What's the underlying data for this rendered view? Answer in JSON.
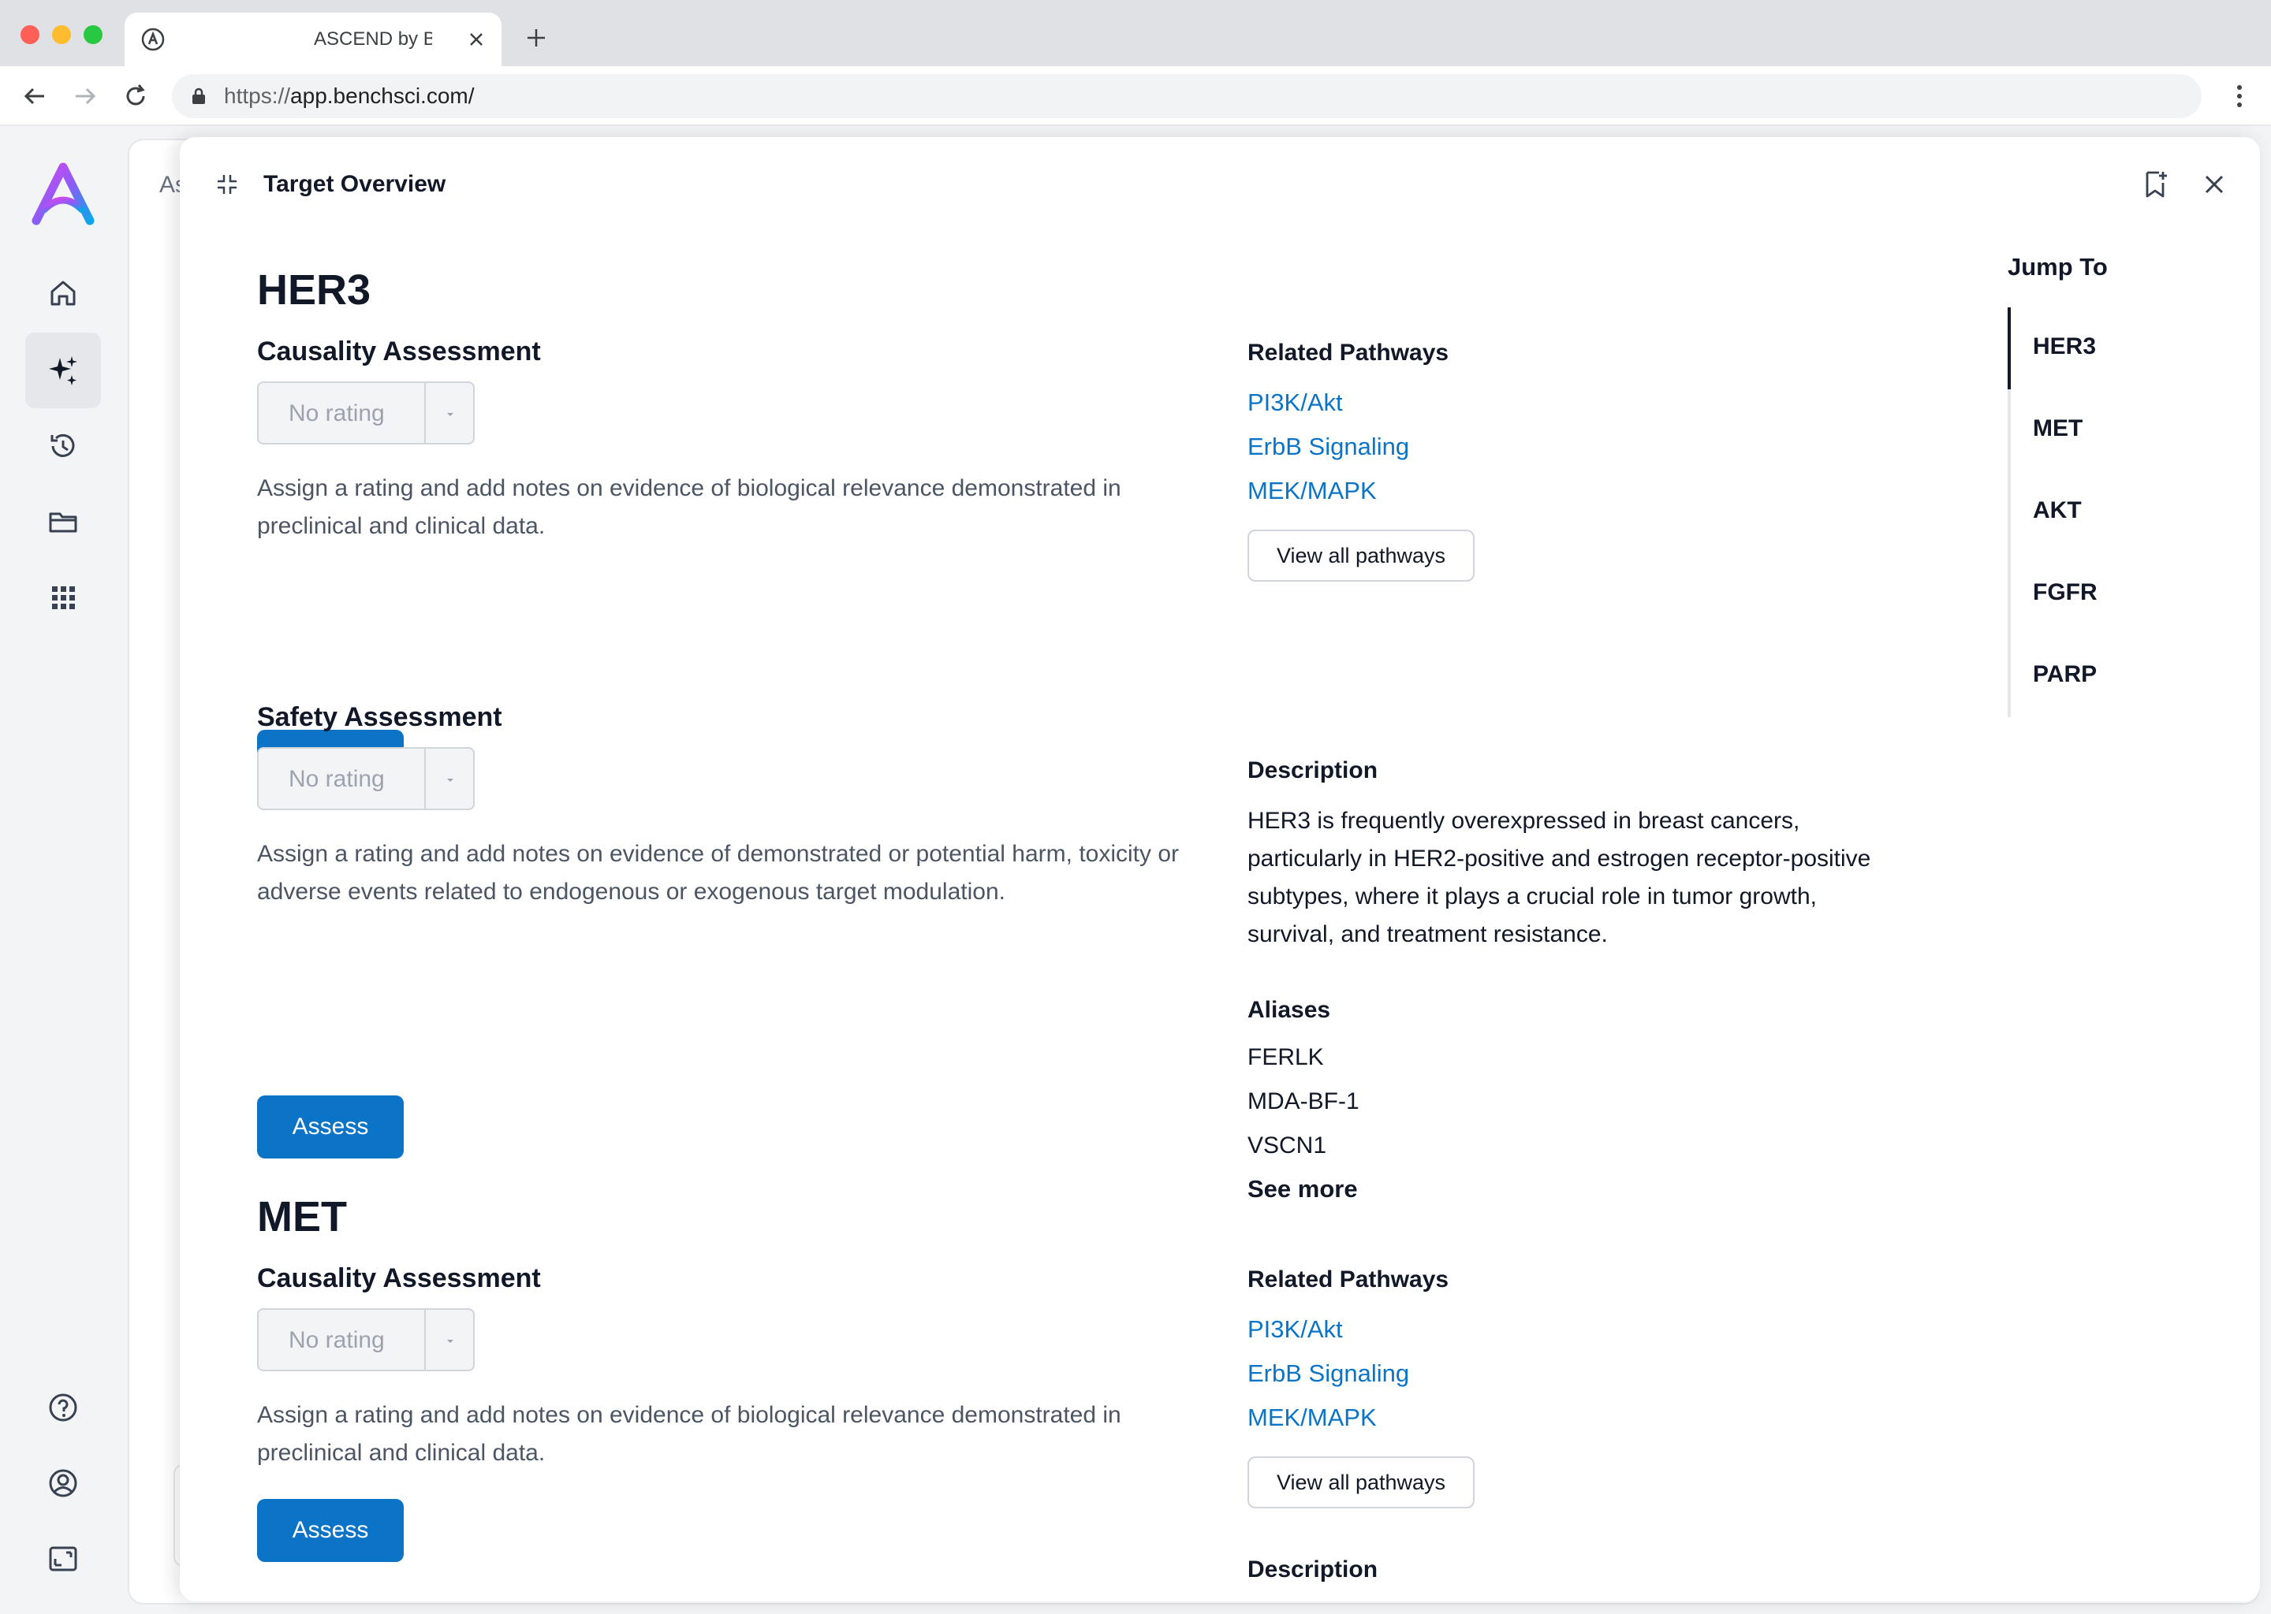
{
  "browser": {
    "tab_title": "ASCEND by BenchSci",
    "url_scheme": "https://",
    "url_host": "app.benchsci.com/"
  },
  "app": {
    "sidebar": [
      "home-icon",
      "sparkle-icon",
      "history-icon",
      "folder-icon",
      "grid-icon",
      "help-icon",
      "account-icon",
      "screen-icon"
    ],
    "page_peek": "As"
  },
  "drawer": {
    "title": "Target Overview"
  },
  "targets": [
    {
      "name": "HER3",
      "causality": {
        "title": "Causality Assessment",
        "rating_placeholder": "No rating",
        "note": "Assign a rating and add notes on evidence of biological relevance demonstrated in preclinical and clinical data.",
        "button": "Assess"
      },
      "safety": {
        "title": "Safety Assessment",
        "rating_placeholder": "No rating",
        "note": "Assign a rating and add notes on evidence of demonstrated or potential harm, toxicity or adverse events related to endogenous or exogenous target modulation.",
        "button": "Assess"
      },
      "pathways_title": "Related Pathways",
      "pathways": [
        "PI3K/Akt",
        "ErbB Signaling",
        "MEK/MAPK"
      ],
      "view_all": "View all pathways",
      "description_title": "Description",
      "description": "HER3 is frequently overexpressed in breast cancers, particularly in HER2-positive and estrogen receptor-positive subtypes, where it plays a crucial role in tumor growth, survival, and treatment resistance.",
      "aliases_title": "Aliases",
      "aliases": [
        "FERLK",
        "MDA-BF-1",
        "VSCN1"
      ],
      "see_more": "See more"
    },
    {
      "name": "MET",
      "causality": {
        "title": "Causality Assessment",
        "rating_placeholder": "No rating",
        "note": "Assign a rating and add notes on evidence of biological relevance demonstrated in preclinical and clinical data.",
        "button": "Assess"
      },
      "pathways_title": "Related Pathways",
      "pathways": [
        "PI3K/Akt",
        "ErbB Signaling",
        "MEK/MAPK"
      ],
      "view_all": "View all pathways",
      "description_title": "Description"
    }
  ],
  "jump_to": {
    "title": "Jump To",
    "items": [
      "HER3",
      "MET",
      "AKT",
      "FGFR",
      "PARP"
    ],
    "active": "HER3"
  }
}
